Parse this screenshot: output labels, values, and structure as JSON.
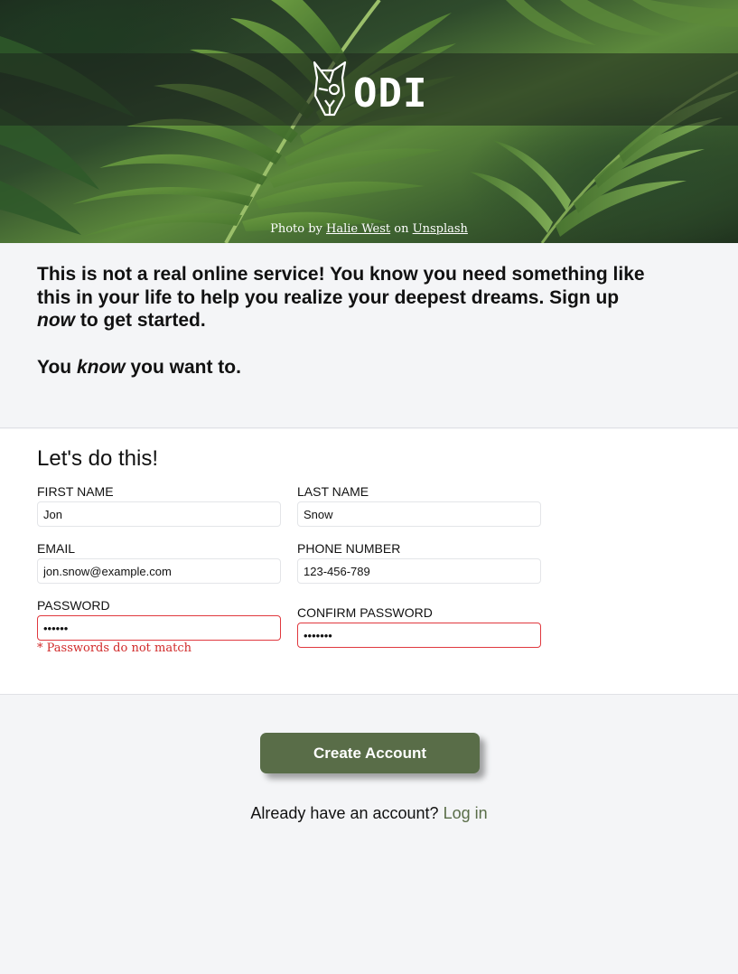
{
  "hero": {
    "logo_text": "ODIN",
    "credit_prefix": "Photo by",
    "photographer": "Halie West",
    "credit_middle": "on",
    "source": "Unsplash"
  },
  "intro": {
    "p1_start": "This is not a real online service! You know you need something like this in your life to help you realize your deepest dreams. Sign up ",
    "p1_em": "now",
    "p1_end": " to get started.",
    "p2_start": "You ",
    "p2_em": "know",
    "p2_end": " you want to."
  },
  "form": {
    "heading": "Let's do this!",
    "first_name": {
      "label": "FIRST NAME",
      "value": "Jon"
    },
    "last_name": {
      "label": "LAST NAME",
      "value": "Snow"
    },
    "email": {
      "label": "EMAIL",
      "value": "jon.snow@example.com"
    },
    "phone": {
      "label": "PHONE NUMBER",
      "value": "123-456-789"
    },
    "password": {
      "label": "PASSWORD",
      "value": "passwd"
    },
    "confirm_password": {
      "label": "CONFIRM PASSWORD",
      "value": "passwrd"
    },
    "password_error": "* Passwords do not match"
  },
  "footer": {
    "create_label": "Create Account",
    "login_prompt": "Already have an account?",
    "login_link": "Log in"
  },
  "colors": {
    "accent": "#596d48",
    "error": "#e0383e",
    "background": "#f4f5f7"
  }
}
